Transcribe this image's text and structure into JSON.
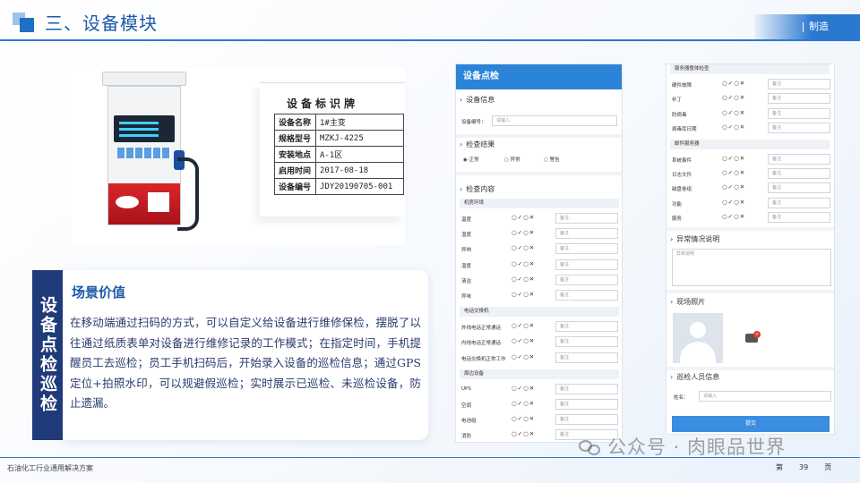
{
  "header": {
    "title": "三、设备模块",
    "tag": "制造"
  },
  "plate": {
    "title": "设备标识牌",
    "rows": [
      {
        "key": "设备名称",
        "value": "1#主变"
      },
      {
        "key": "规格型号",
        "value": "MZKJ-4225"
      },
      {
        "key": "安装地点",
        "value": "A-1区"
      },
      {
        "key": "启用时间",
        "value": "2017-08-18"
      },
      {
        "key": "设备编号",
        "value": "JDY20190705-001"
      }
    ]
  },
  "scene": {
    "vertical_title": "设备点检巡检",
    "heading": "场景价值",
    "body": "在移动端通过扫码的方式，可以自定义给设备进行维修保检，摆脱了以往通过纸质表单对设备进行维修记录的工作模式；在指定时间，手机提醒员工去巡检；员工手机扫码后，开始录入设备的巡检信息；通过GPS定位+拍照水印，可以规避假巡检；实时展示已巡检、未巡检设备，防止遗漏。"
  },
  "form1": {
    "header": "设备点检",
    "device_info": "设备信息",
    "device_no_label": "设备编号：",
    "device_no_placeholder": "请输入",
    "result_title": "检查结果",
    "results": [
      "正常",
      "异常",
      "警告"
    ],
    "content_title": "检查内容",
    "groups": [
      {
        "name": "机房环境",
        "items": [
          "温度",
          "湿度",
          "异响",
          "湿度",
          "清洁",
          "异味"
        ]
      },
      {
        "name": "电话交换机",
        "items": [
          "外线电话正常通话",
          "内线电话正常通话",
          "电话交换机正常工作"
        ]
      },
      {
        "name": "周边设备",
        "items": [
          "UPS",
          "空调",
          "电池组",
          "消防"
        ]
      }
    ],
    "radio_text": "○✓○✕",
    "note_placeholder": "备注"
  },
  "form2": {
    "groups": [
      {
        "name": "服务器整体检查",
        "items": [
          "硬件故障",
          "补丁",
          "防病毒",
          "病毒库日期"
        ]
      },
      {
        "name": "邮件服务器",
        "items": [
          "系统事件",
          "日志文件",
          "磁盘卷组",
          "功能",
          "服务"
        ]
      }
    ],
    "radio_text": "○✓○✕",
    "note_placeholder": "备注",
    "abnormal_title": "异常情况说明",
    "abnormal_placeholder": "异常说明",
    "photo_title": "现场照片",
    "photo_badge": "+",
    "inspector_title": "巡检人员信息",
    "name_label": "姓名：",
    "name_placeholder": "请输入",
    "submit": "提交"
  },
  "footer": {
    "left": "石油化工行业通用解决方案",
    "page_prefix": "第",
    "page_no": "39",
    "page_suffix": "页",
    "watermark": "公众号 · 肉眼品世界"
  },
  "colors": {
    "primary": "#2b78d0",
    "title_box": "#1f3b79",
    "pump_red": "#d9262b"
  }
}
